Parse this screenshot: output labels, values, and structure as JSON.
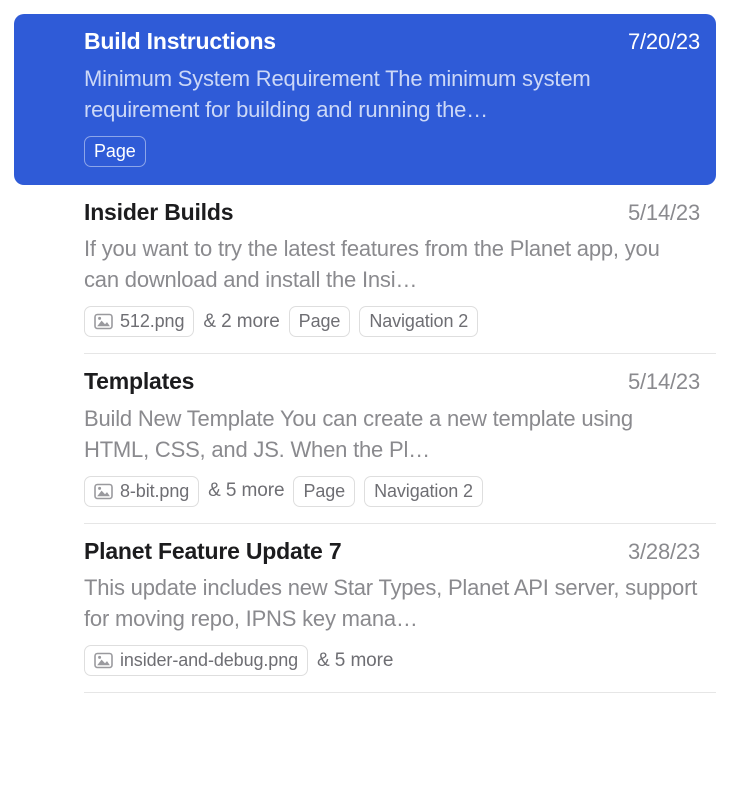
{
  "list": {
    "name": "search-results-list",
    "items": [
      {
        "title": "Build Instructions",
        "date": "7/20/23",
        "snippet": "Minimum System Requirement The minimum system requirement for building and running the…",
        "selected": true,
        "attachment": null,
        "more": null,
        "tags": [
          "Page"
        ]
      },
      {
        "title": "Insider Builds",
        "date": "5/14/23",
        "snippet": "If you want to try the latest features from the Planet app, you can download and install the Insi…",
        "selected": false,
        "attachment": "512.png",
        "more": "& 2 more",
        "tags": [
          "Page",
          "Navigation 2"
        ]
      },
      {
        "title": "Templates",
        "date": "5/14/23",
        "snippet": "Build New Template You can create a new template using HTML, CSS, and JS. When the Pl…",
        "selected": false,
        "attachment": "8-bit.png",
        "more": "& 5 more",
        "tags": [
          "Page",
          "Navigation 2"
        ]
      },
      {
        "title": "Planet Feature Update 7",
        "date": "3/28/23",
        "snippet": "This update includes new Star Types, Planet API server, support for moving repo, IPNS key mana…",
        "selected": false,
        "attachment": "insider-and-debug.png",
        "more": "& 5 more",
        "tags": []
      }
    ]
  },
  "icons": {
    "attachment_icon": "image-icon"
  },
  "colors": {
    "selection_blue": "#2f5bd7",
    "title": "#1c1c1e",
    "secondary_text": "#8a8a8e",
    "divider": "#e6e6e6",
    "tag_border": "#dedede",
    "selected_snippet": "#ccd8f7"
  }
}
